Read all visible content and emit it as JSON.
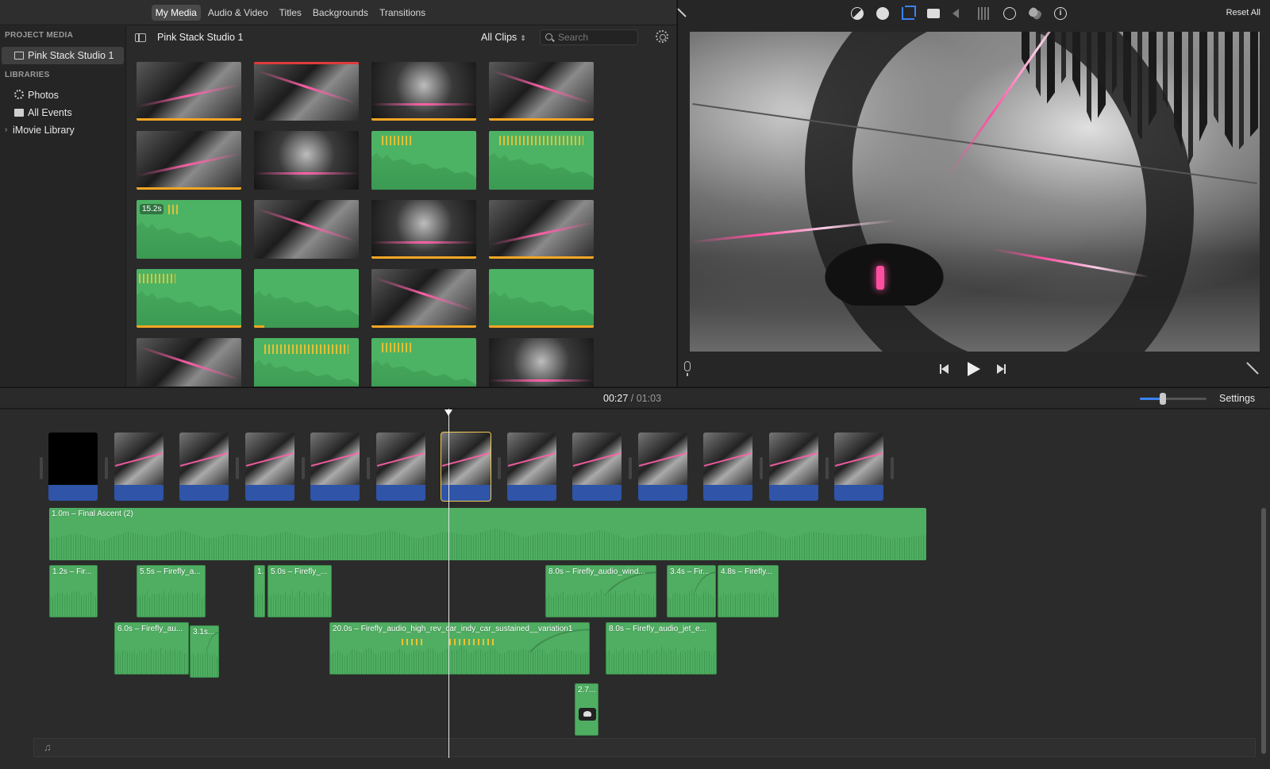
{
  "top_tabs": [
    "My Media",
    "Audio & Video",
    "Titles",
    "Backgrounds",
    "Transitions"
  ],
  "active_tab": "My Media",
  "sidebar": {
    "project_media_header": "PROJECT MEDIA",
    "project_item": "Pink Stack Studio 1",
    "libraries_header": "LIBRARIES",
    "library_items": [
      "Photos",
      "All Events",
      "iMovie Library"
    ]
  },
  "browser": {
    "project_title": "Pink Stack Studio 1",
    "filter": "All Clips",
    "search_placeholder": "Search",
    "badge_duration": "15.2s"
  },
  "viewer": {
    "reset_all": "Reset All"
  },
  "timeline": {
    "current_time": "00:27",
    "separator": "/",
    "total_time": "01:03",
    "settings": "Settings",
    "zoom_level": 0.35,
    "music_track_label": "1.0m – Final Ascent (2)",
    "audio_clips": [
      "1.2s – Fir...",
      "5.5s – Firefly_a...",
      "1.",
      "5.0s – Firefly_...",
      "8.0s – Firefly_audio_wind...",
      "3.4s – Fir...",
      "4.8s – Firefly...",
      "6.0s – Firefly_au...",
      "3.1s...",
      "20.0s – Firefly_audio_high_rev_car_indy_car_sustained__variation1",
      "8.0s – Firefly_audio_jet_e...",
      "2.7..."
    ]
  },
  "colors": {
    "audio_green": "#4fae62",
    "video_audio_blue": "#2f54a8",
    "selection_yellow": "#f2c94c",
    "accent_blue": "#3b82f6",
    "used_orange": "#f5a623"
  }
}
